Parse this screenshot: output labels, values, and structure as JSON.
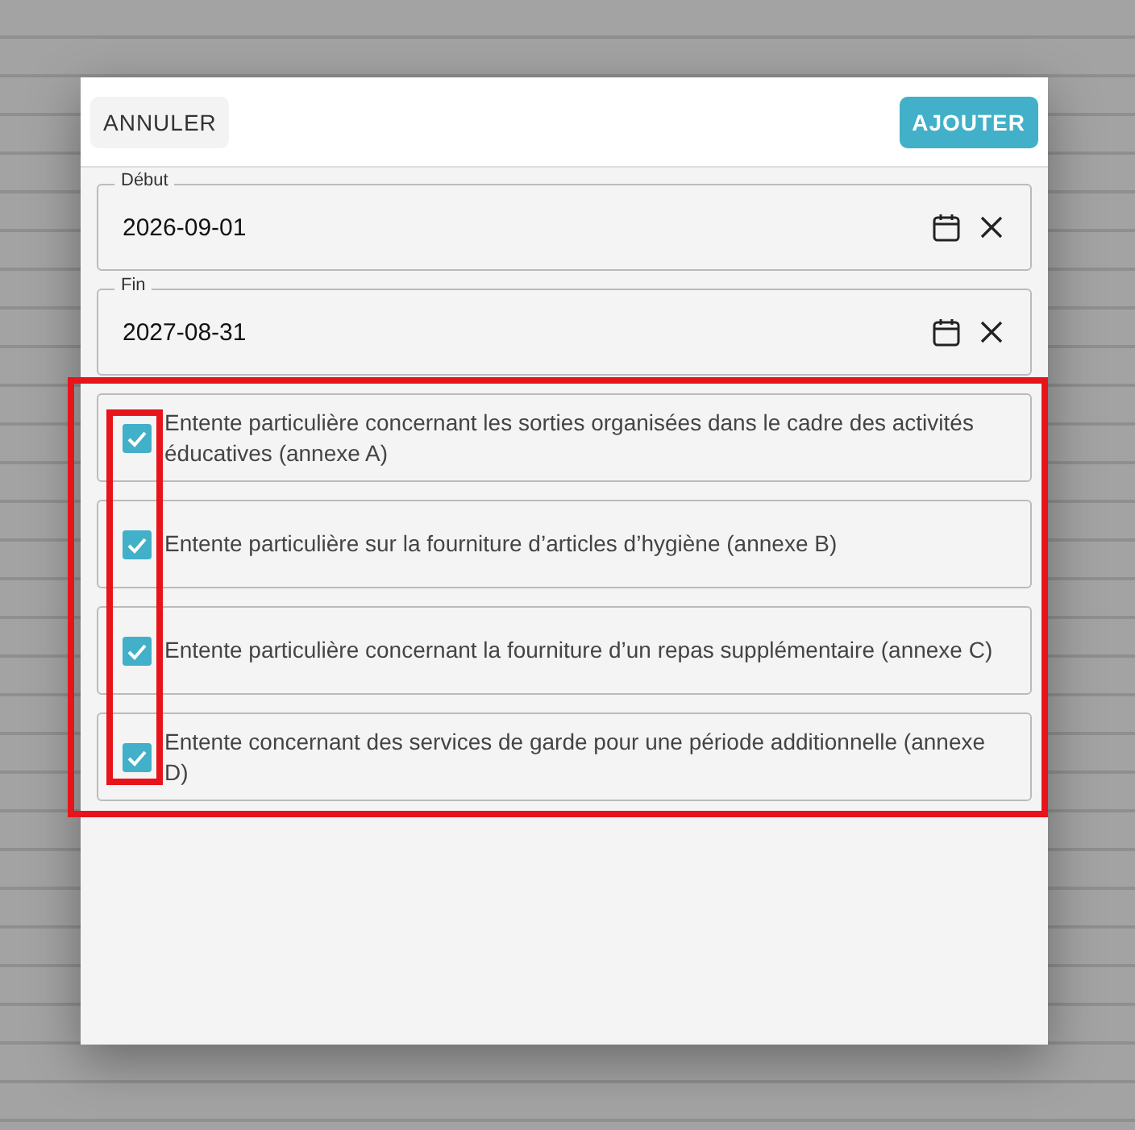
{
  "header": {
    "cancel_button": "ANNULER",
    "add_button": "AJOUTER"
  },
  "date_fields": [
    {
      "label": "Début",
      "value": "2026-09-01"
    },
    {
      "label": "Fin",
      "value": "2027-08-31"
    }
  ],
  "agreements": [
    {
      "label": "Entente particulière concernant les sorties organisées dans le cadre des activités éducatives (annexe A)",
      "checked": true
    },
    {
      "label": "Entente particulière sur la fourniture d’articles d’hygiène (annexe B)",
      "checked": true
    },
    {
      "label": "Entente particulière concernant la fourniture d’un repas supplémentaire (annexe C)",
      "checked": true
    },
    {
      "label": "Entente concernant des services de garde pour une période additionnelle (annexe D)",
      "checked": true
    }
  ],
  "annotations": {
    "list_frame": true,
    "checkbox_frame": true
  }
}
